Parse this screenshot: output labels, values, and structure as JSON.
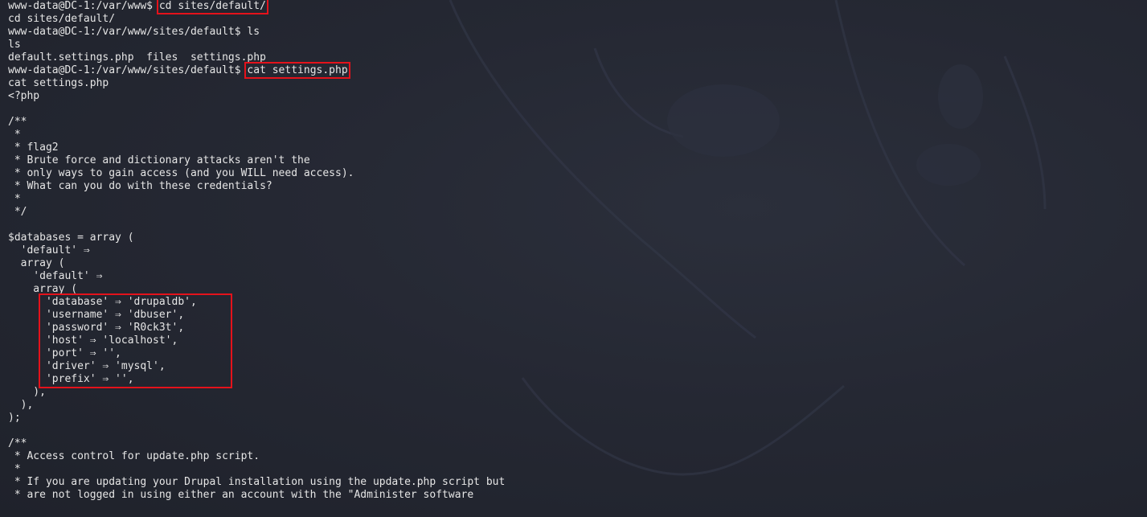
{
  "terminal": {
    "lines": [
      {
        "prompt": "www-data@DC-1:/var/www$ ",
        "cmd": "cd sites/default/",
        "highlight": true
      },
      {
        "text": "cd sites/default/"
      },
      {
        "prompt": "www-data@DC-1:/var/www/sites/default$ ",
        "cmd": "ls",
        "highlight": false
      },
      {
        "text": "ls"
      },
      {
        "text": "default.settings.php  files  settings.php"
      },
      {
        "prompt": "www-data@DC-1:/var/www/sites/default$ ",
        "cmd": "cat settings.php",
        "highlight": true
      },
      {
        "text": "cat settings.php"
      },
      {
        "text": "<?php"
      },
      {
        "text": ""
      },
      {
        "text": "/**"
      },
      {
        "text": " *"
      },
      {
        "text": " * flag2"
      },
      {
        "text": " * Brute force and dictionary attacks aren't the"
      },
      {
        "text": " * only ways to gain access (and you WILL need access)."
      },
      {
        "text": " * What can you do with these credentials?"
      },
      {
        "text": " *"
      },
      {
        "text": " */"
      },
      {
        "text": ""
      },
      {
        "text": "$databases = array ("
      },
      {
        "text": "  'default' ⇒"
      },
      {
        "text": "  array ("
      },
      {
        "text": "    'default' ⇒"
      },
      {
        "text": "    array ("
      },
      {
        "text": "      'database' ⇒ 'drupaldb',"
      },
      {
        "text": "      'username' ⇒ 'dbuser',"
      },
      {
        "text": "      'password' ⇒ 'R0ck3t',"
      },
      {
        "text": "      'host' ⇒ 'localhost',"
      },
      {
        "text": "      'port' ⇒ '',"
      },
      {
        "text": "      'driver' ⇒ 'mysql',"
      },
      {
        "text": "      'prefix' ⇒ '',"
      },
      {
        "text": "    ),"
      },
      {
        "text": "  ),"
      },
      {
        "text": ");"
      },
      {
        "text": ""
      },
      {
        "text": "/**"
      },
      {
        "text": " * Access control for update.php script."
      },
      {
        "text": " *"
      },
      {
        "text": " * If you are updating your Drupal installation using the update.php script but"
      },
      {
        "text": " * are not logged in using either an account with the \"Administer software"
      }
    ]
  },
  "colors": {
    "background": "#20232d",
    "text": "#e6e6e6",
    "highlight_border": "#e4121b"
  }
}
